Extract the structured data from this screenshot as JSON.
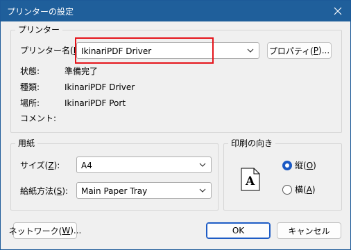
{
  "window": {
    "title": "プリンターの設定"
  },
  "printer_group": {
    "label": "プリンター",
    "name_label": "プリンター名(",
    "name_key": "N",
    "name_label_end": "):",
    "name_value": "IkinariPDF Driver",
    "properties_button": {
      "pre": "プロパティ(",
      "key": "P",
      "post": ")..."
    },
    "status_label": "状態:",
    "status_value": "準備完了",
    "type_label": "種類:",
    "type_value": "IkinariPDF Driver",
    "location_label": "場所:",
    "location_value": "IkinariPDF Port",
    "comment_label": "コメント:",
    "comment_value": ""
  },
  "paper_group": {
    "label": "用紙",
    "size_label": {
      "pre": "サイズ(",
      "key": "Z",
      "post": "):"
    },
    "size_value": "A4",
    "source_label": {
      "pre": "給紙方法(",
      "key": "S",
      "post": "):"
    },
    "source_value": "Main Paper Tray"
  },
  "orientation_group": {
    "label": "印刷の向き",
    "preview_glyph": "A",
    "portrait": {
      "pre": "縦(",
      "key": "O",
      "post": ")",
      "selected": true
    },
    "landscape": {
      "pre": "横(",
      "key": "A",
      "post": ")",
      "selected": false
    }
  },
  "footer": {
    "network_button": {
      "pre": "ネットワーク(",
      "key": "W",
      "post": ")..."
    },
    "ok_button": "OK",
    "cancel_button": "キャンセル"
  },
  "colors": {
    "titlebar": "#1f5f9b",
    "accent": "#1a59c4",
    "highlight": "#e5141b"
  }
}
